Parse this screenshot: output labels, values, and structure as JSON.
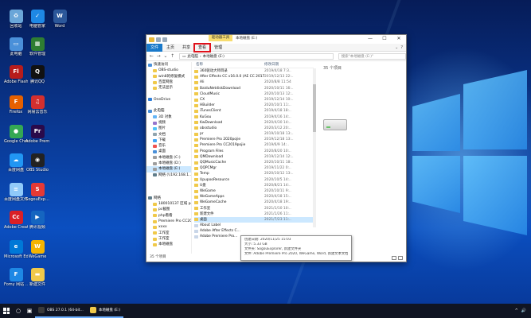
{
  "desktop": {
    "icons": [
      {
        "label": "回收站",
        "icon": "recycle-bin-icon",
        "color": "#6aa6d8",
        "glyph": "♻"
      },
      {
        "label": "电脑管家",
        "icon": "shield-icon",
        "color": "#1e88e5",
        "glyph": "✓"
      },
      {
        "label": "Word",
        "icon": "word-icon",
        "color": "#2b579a",
        "glyph": "W"
      },
      {
        "label": "此电脑",
        "icon": "computer-icon",
        "color": "#4a90d9",
        "glyph": "▭"
      },
      {
        "label": "软件管理",
        "icon": "software-manager-icon",
        "color": "#2e7d32",
        "glyph": "▦"
      },
      {
        "label": "Adobe Flash Professio...",
        "icon": "flash-icon",
        "color": "#b71c1c",
        "glyph": "Fl"
      },
      {
        "label": "腾讯QQ",
        "icon": "qq-icon",
        "color": "#111111",
        "glyph": "Q"
      },
      {
        "label": "Firefox",
        "icon": "firefox-icon",
        "color": "#e66000",
        "glyph": "F"
      },
      {
        "label": "网易云音乐",
        "icon": "netease-music-icon",
        "color": "#d32f2f",
        "glyph": "♫"
      },
      {
        "label": "Google Chrome",
        "icon": "chrome-icon",
        "color": "#34a853",
        "glyph": "●"
      },
      {
        "label": "Adobe Premie...",
        "icon": "premiere-icon",
        "color": "#2a0a4a",
        "glyph": "Pr"
      },
      {
        "label": "百度网盘",
        "icon": "baidu-netdisk-icon",
        "color": "#2196f3",
        "glyph": "☁"
      },
      {
        "label": "OBS Studio",
        "icon": "obs-icon",
        "color": "#222222",
        "glyph": "◉"
      },
      {
        "label": "百度网盘文件快...",
        "icon": "document-icon",
        "color": "#90caf9",
        "glyph": "≡"
      },
      {
        "label": "SogouExp...",
        "icon": "sogou-icon",
        "color": "#e53935",
        "glyph": "S"
      },
      {
        "label": "Adobe Creat...",
        "icon": "creative-cloud-icon",
        "color": "#da1f26",
        "glyph": "Cc"
      },
      {
        "label": "腾讯视频",
        "icon": "tencent-video-icon",
        "color": "#1565c0",
        "glyph": "▶"
      },
      {
        "label": "Microsoft Edge",
        "icon": "edge-icon",
        "color": "#0078d7",
        "glyph": "e"
      },
      {
        "label": "WeGame",
        "icon": "wegame-icon",
        "color": "#f5b400",
        "glyph": "W"
      },
      {
        "label": "Fomy 网站 ...",
        "icon": "fomy-icon",
        "color": "#1e88e5",
        "glyph": "F"
      },
      {
        "label": "新建文件",
        "icon": "folder-icon",
        "color": "#f0c94a",
        "glyph": "▬"
      }
    ]
  },
  "explorer": {
    "context_tab": "驱动器工具",
    "title": "本地磁盘 (E:)",
    "controls": {
      "minimize": "—",
      "maximize": "☐",
      "close": "✕"
    },
    "ribbon_tabs": [
      "文件",
      "主页",
      "共享",
      "查看",
      "管理"
    ],
    "highlighted_tab_index": 3,
    "highlight_color": "#e0101a",
    "address_path": [
      "此电脑",
      "本地磁盘 (E:)"
    ],
    "search_placeholder": "搜索\"本地磁盘 (E:)\"",
    "columns": {
      "name": "名称",
      "date": "修改日期"
    },
    "nav_items": [
      {
        "label": "快速访问",
        "color": "#4a90d9"
      },
      {
        "label": "OBS-studio",
        "color": "#f0c94a"
      },
      {
        "label": "win8的修复模式",
        "color": "#f0c94a"
      },
      {
        "label": "百度网盘",
        "color": "#f0c94a"
      },
      {
        "label": "无法显示",
        "color": "#f0c94a"
      },
      {
        "label": "",
        "color": "#ffffff"
      },
      {
        "label": "OneDrive",
        "color": "#2f7ed8"
      },
      {
        "label": "",
        "color": "#ffffff"
      },
      {
        "label": "此电脑",
        "color": "#4a90d9"
      },
      {
        "label": "3D 对象",
        "color": "#64b5f6"
      },
      {
        "label": "视频",
        "color": "#9575cd"
      },
      {
        "label": "图片",
        "color": "#4fc3f7"
      },
      {
        "label": "文档",
        "color": "#90a4ae"
      },
      {
        "label": "下载",
        "color": "#42a5f5"
      },
      {
        "label": "音乐",
        "color": "#ef5350"
      },
      {
        "label": "桌面",
        "color": "#4a90d9"
      },
      {
        "label": "本地磁盘 (C:)",
        "color": "#9e9e9e"
      },
      {
        "label": "本地磁盘 (D:)",
        "color": "#9e9e9e"
      },
      {
        "label": "本地磁盘 (E:)",
        "color": "#9e9e9e",
        "selected": true
      },
      {
        "label": "网络 (\\\\192.168.1...)",
        "color": "#607d8b"
      },
      {
        "label": "",
        "color": "#ffffff"
      },
      {
        "label": "",
        "color": "#ffffff"
      },
      {
        "label": "",
        "color": "#ffffff"
      },
      {
        "label": "网络",
        "color": "#607d8b"
      },
      {
        "label": "180010137 区域 pc...",
        "color": "#f0c94a"
      },
      {
        "label": "pc截图",
        "color": "#f0c94a"
      },
      {
        "label": "php看看",
        "color": "#f0c94a"
      },
      {
        "label": "Premiere Pro CC20...",
        "color": "#f0c94a"
      },
      {
        "label": "xxxx",
        "color": "#f0c94a"
      },
      {
        "label": "工作室",
        "color": "#f0c94a"
      },
      {
        "label": "工作室",
        "color": "#f0c94a"
      },
      {
        "label": "本地磁盘",
        "color": "#f0c94a"
      }
    ],
    "files": [
      {
        "name": "360驱动大师目录",
        "date": "2019/4/18 7:3..",
        "type": "folder"
      },
      {
        "name": "After Effects CC v16.0.0 (AE CC 2017)",
        "date": "2019/12/13 22:..",
        "type": "folder"
      },
      {
        "name": "Ali",
        "date": "2020/8/8 11:54",
        "type": "folder"
      },
      {
        "name": "BaiduNetdiskDownload",
        "date": "2020/10/11 16:..",
        "type": "folder"
      },
      {
        "name": "CloudMusic",
        "date": "2020/10/13 12:..",
        "type": "folder"
      },
      {
        "name": "CX",
        "date": "2019/12/14 10:..",
        "type": "folder"
      },
      {
        "name": "HBuilder",
        "date": "2020/10/1 11:..",
        "type": "folder"
      },
      {
        "name": "iTunesClient",
        "date": "2019/4/18 18:..",
        "type": "folder"
      },
      {
        "name": "KuGou",
        "date": "2019/4/16 14:..",
        "type": "folder"
      },
      {
        "name": "KwDownload",
        "date": "2020/4/30 14:..",
        "type": "folder"
      },
      {
        "name": "obsstudio",
        "date": "2020/3/12 20:..",
        "type": "folder"
      },
      {
        "name": "pr",
        "date": "2019/10/18 13:..",
        "type": "folder"
      },
      {
        "name": "Premiere Pro 2020pojie",
        "date": "2019/12/18 13:..",
        "type": "folder"
      },
      {
        "name": "Premiere Pro CC2019pojie",
        "date": "2019/6/9 14:..",
        "type": "folder"
      },
      {
        "name": "Program Files",
        "date": "2020/8/20 10:..",
        "type": "folder"
      },
      {
        "name": "QMDownload",
        "date": "2019/12/14 12:..",
        "type": "folder"
      },
      {
        "name": "QQMusicCache",
        "date": "2020/10/11 18:..",
        "type": "folder"
      },
      {
        "name": "QQPCMgr",
        "date": "2019/11/22 0:..",
        "type": "folder"
      },
      {
        "name": "Temp",
        "date": "2020/10/12 13:..",
        "type": "folder"
      },
      {
        "name": "UpupooResource",
        "date": "2020/10/5 14:..",
        "type": "folder"
      },
      {
        "name": "U盘",
        "date": "2020/8/21 14:..",
        "type": "folder"
      },
      {
        "name": "WeGame",
        "date": "2020/10/11 9:..",
        "type": "folder"
      },
      {
        "name": "WeGameApps",
        "date": "2020/4/18 15:..",
        "type": "folder"
      },
      {
        "name": "WeGameCache",
        "date": "2020/4/18 19:..",
        "type": "folder"
      },
      {
        "name": "工作室",
        "date": "2021/1/10 10:..",
        "type": "folder"
      },
      {
        "name": "新建文件",
        "date": "2021/1/26 11:..",
        "type": "folder"
      },
      {
        "name": "桌面",
        "date": "2021/7/23 11:..",
        "type": "folder",
        "selected": true
      },
      {
        "name": "About Label",
        "date": "",
        "type": "file"
      },
      {
        "name": "Adobe After Effects C...",
        "date": "",
        "type": "file"
      },
      {
        "name": "Adobe Premiere Pro...",
        "date": "",
        "type": "file"
      }
    ],
    "preview_count": "35 个项目",
    "tooltip": {
      "line1": "创建日期: 2020/11/25 15:03",
      "line2": "大小: 5.33 GB",
      "line3": "文件夹: SogouExplorer, 新建文件夹",
      "line4": "文件: Adobe Premiere Pro 2020, WeGame, Word, 新建文本文档"
    },
    "status": "35 个项目"
  },
  "taskbar": {
    "apps": [
      {
        "label": "OBS 27.0.1 (64-bit...",
        "color": "#3a3a3a"
      },
      {
        "label": "本地磁盘 (E:)",
        "color": "#f0c94a"
      }
    ],
    "tray_caret": "^",
    "tray_volume": "🔊"
  }
}
